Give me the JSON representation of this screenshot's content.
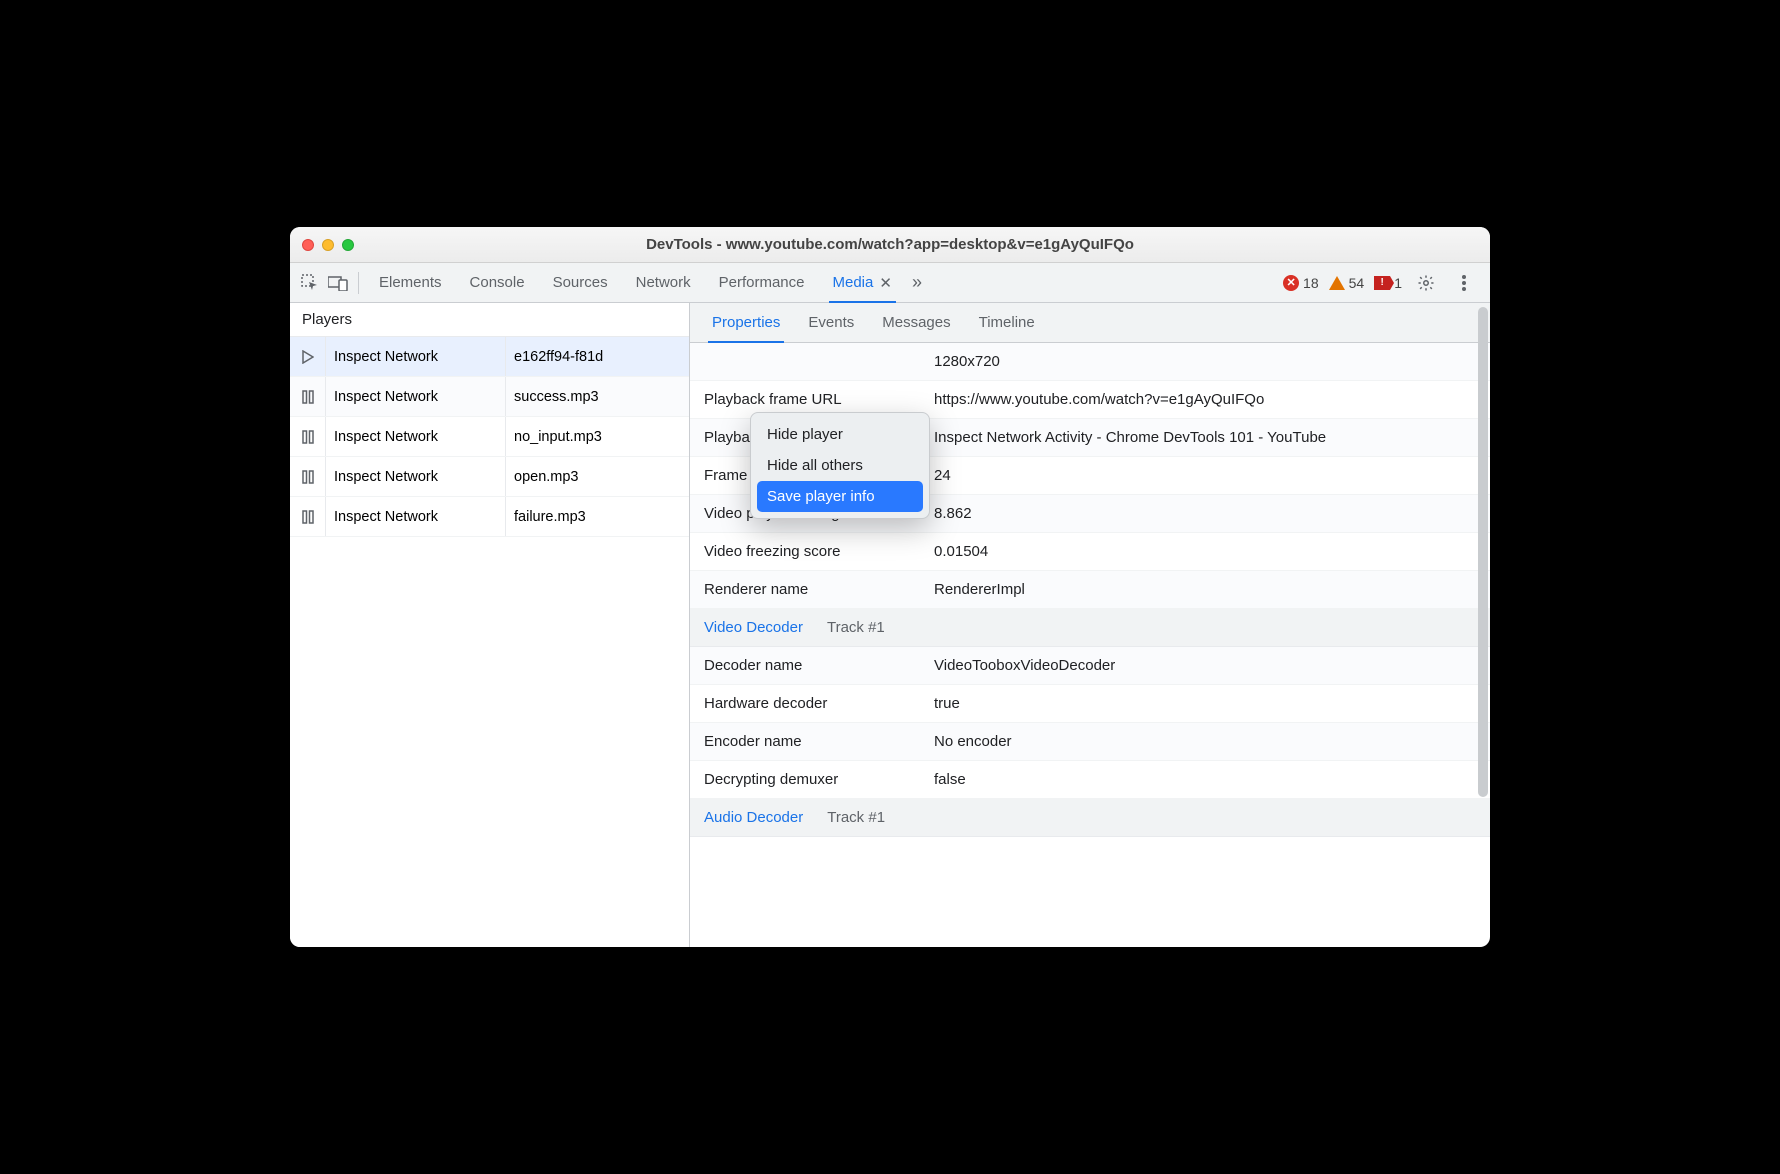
{
  "window": {
    "title": "DevTools - www.youtube.com/watch?app=desktop&v=e1gAyQuIFQo"
  },
  "toolbar": {
    "tabs": [
      "Elements",
      "Console",
      "Sources",
      "Network",
      "Performance",
      "Media"
    ],
    "active_tab": "Media",
    "errors": "18",
    "warnings": "54",
    "issues": "1"
  },
  "sidebar": {
    "header": "Players",
    "rows": [
      {
        "icon": "play",
        "name": "Inspect Network",
        "file": "e162ff94-f81d"
      },
      {
        "icon": "pause",
        "name": "Inspect Network",
        "file": "success.mp3"
      },
      {
        "icon": "pause",
        "name": "Inspect Network",
        "file": "no_input.mp3"
      },
      {
        "icon": "pause",
        "name": "Inspect Network",
        "file": "open.mp3"
      },
      {
        "icon": "pause",
        "name": "Inspect Network",
        "file": "failure.mp3"
      }
    ],
    "selected_index": 0
  },
  "context_menu": {
    "items": [
      "Hide player",
      "Hide all others",
      "Save player info"
    ],
    "hover_index": 2
  },
  "subtabs": {
    "items": [
      "Properties",
      "Events",
      "Messages",
      "Timeline"
    ],
    "active": "Properties"
  },
  "properties": [
    {
      "k": "",
      "v": "1280x720"
    },
    {
      "k": "Playback frame URL",
      "v": "https://www.youtube.com/watch?v=e1gAyQuIFQo"
    },
    {
      "k": "Playback frame title",
      "v": "Inspect Network Activity - Chrome DevTools 101 - YouTube"
    },
    {
      "k": "Frame rate",
      "v": "24"
    },
    {
      "k": "Video playback roughness",
      "v": "8.862"
    },
    {
      "k": "Video freezing score",
      "v": "0.01504"
    },
    {
      "k": "Renderer name",
      "v": "RendererImpl"
    }
  ],
  "video_decoder": {
    "title": "Video Decoder",
    "track": "Track #1",
    "rows": [
      {
        "k": "Decoder name",
        "v": "VideoTooboxVideoDecoder"
      },
      {
        "k": "Hardware decoder",
        "v": "true"
      },
      {
        "k": "Encoder name",
        "v": "No encoder"
      },
      {
        "k": "Decrypting demuxer",
        "v": "false"
      }
    ]
  },
  "audio_decoder": {
    "title": "Audio Decoder",
    "track": "Track #1"
  }
}
